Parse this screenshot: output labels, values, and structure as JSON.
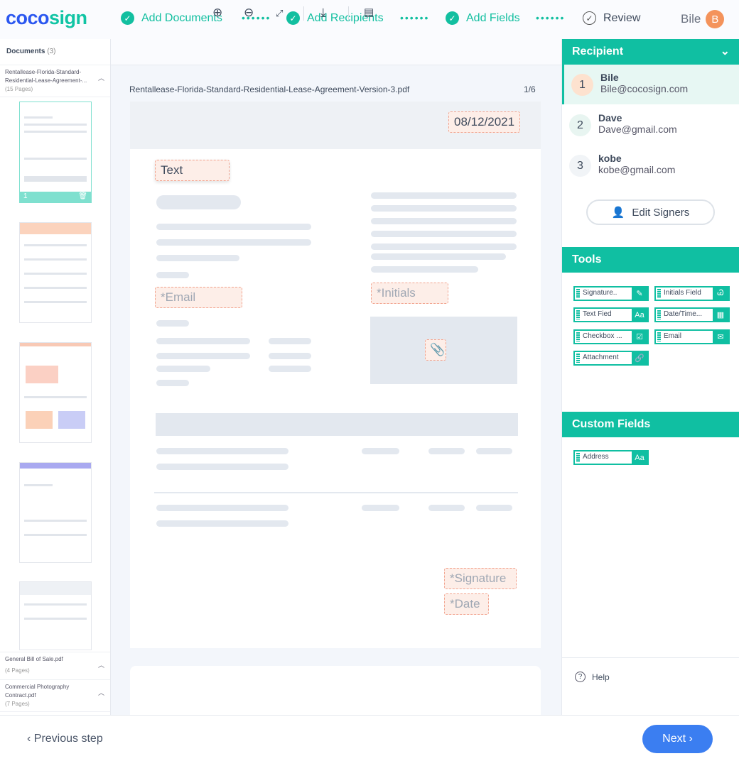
{
  "logo": {
    "part1": "coco",
    "part2": "sign"
  },
  "steps": [
    {
      "label": "Add Documents",
      "done": true
    },
    {
      "label": "Add Recipients",
      "done": true
    },
    {
      "label": "Add Fields",
      "done": true
    },
    {
      "label": "Review",
      "done": false
    }
  ],
  "user": {
    "name": "Bile",
    "initial": "B"
  },
  "sidebar": {
    "title": "Documents",
    "count": "(3)",
    "docs": [
      {
        "name1": "Rentallease-Florida-Standard-",
        "name2": "Residential-Lease-Agreement-...",
        "pages": "(15 Pages)"
      },
      {
        "name1": "General Bill of Sale.pdf",
        "name2": "",
        "pages": "(4 Pages)"
      },
      {
        "name1": "Commercial Photography",
        "name2": "Contract.pdf",
        "pages": "(7 Pages)"
      }
    ],
    "selected_page": "1"
  },
  "toolbar": [
    "zoom-in",
    "zoom-out",
    "fit-screen",
    "download",
    "document-settings"
  ],
  "document": {
    "filename": "Rentallease-Florida-Standard-Residential-Lease-Agreement-Version-3.pdf",
    "page": "1/6",
    "fields": {
      "date_value": "08/12/2021",
      "text": "Text",
      "email": "*Email",
      "initials": "*Initials",
      "signature": "*Signature",
      "date": "*Date"
    }
  },
  "recipient": {
    "title": "Recipient",
    "list": [
      {
        "n": "1",
        "name": "Bile",
        "email": "Bile@cocosign.com"
      },
      {
        "n": "2",
        "name": "Dave",
        "email": "Dave@gmail.com"
      },
      {
        "n": "3",
        "name": "kobe",
        "email": "kobe@gmail.com"
      }
    ],
    "edit": "Edit Signers"
  },
  "tools": {
    "title": "Tools",
    "items": [
      "Signature..",
      "Initials Field",
      "Text Fied",
      "Date/Time...",
      "Checkbox ...",
      "Email",
      "Attachment"
    ]
  },
  "custom": {
    "title": "Custom Fields",
    "items": [
      "Address"
    ]
  },
  "help": "Help",
  "footer": {
    "prev": "Previous step",
    "next": "Next"
  },
  "colors": {
    "accent": "#10bfa2",
    "primary": "#3b7ef1",
    "field": "#f2a38e"
  }
}
